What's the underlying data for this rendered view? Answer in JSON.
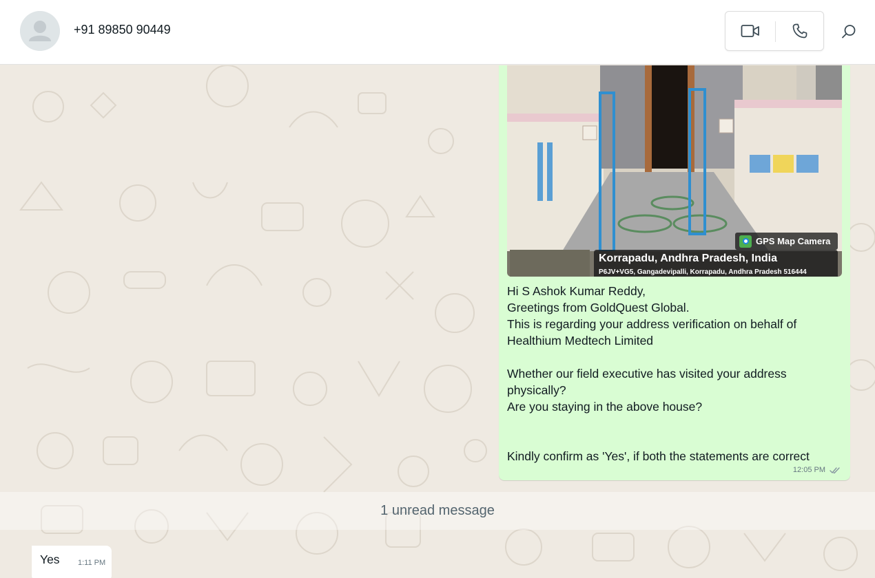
{
  "header": {
    "contact_name": "+91 89850 90449",
    "icons": [
      "avatar-placeholder",
      "video-call-icon",
      "voice-call-icon",
      "search-icon"
    ]
  },
  "outgoing_message": {
    "photo": {
      "gps_label": "GPS Map Camera",
      "place": "Korrapadu, Andhra Pradesh, India",
      "address": "P6JV+VG5, Gangadevipalli, Korrapadu, Andhra Pradesh 516444"
    },
    "lines": [
      "Hi S Ashok Kumar Reddy,",
      "Greetings from GoldQuest Global.",
      "This is regarding your address verification on behalf of",
      "Healthium Medtech Limited",
      "",
      "Whether our field executive has visited your address",
      "physically?",
      "Are you staying in the above house?",
      "",
      "",
      "Kindly confirm as 'Yes', if both the statements are correct"
    ],
    "time": "12:05 PM",
    "status_icon": "double-check-icon"
  },
  "unread_divider": "1 unread message",
  "incoming_message": {
    "text": "Yes",
    "time": "1:11 PM"
  },
  "colors": {
    "chat_background": "#efeae2",
    "outgoing_bubble": "#d9fdd3",
    "incoming_bubble": "#ffffff",
    "meta_text": "#667781"
  }
}
